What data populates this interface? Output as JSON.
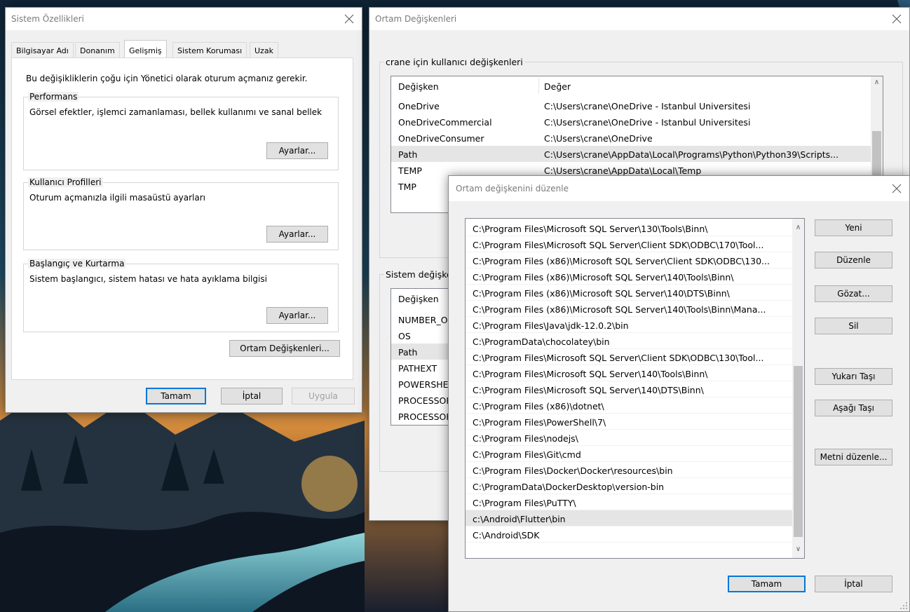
{
  "sysprops": {
    "title": "Sistem Özellikleri",
    "tabs": [
      "Bilgisayar Adı",
      "Donanım",
      "Gelişmiş",
      "Sistem Koruması",
      "Uzak"
    ],
    "admin_note": "Bu değişikliklerin çoğu için Yönetici olarak oturum açmanız gerekir.",
    "perf_label": "Performans",
    "perf_desc": "Görsel efektler, işlemci zamanlaması, bellek kullanımı ve sanal bellek",
    "profiles_label": "Kullanıcı Profilleri",
    "profiles_desc": "Oturum açmanızla ilgili masaüstü ayarları",
    "startup_label": "Başlangıç ve Kurtarma",
    "startup_desc": "Sistem başlangıcı, sistem hatası ve hata ayıklama bilgisi",
    "settings_btn": "Ayarlar...",
    "env_btn": "Ortam Değişkenleri...",
    "ok_btn": "Tamam",
    "cancel_btn": "İptal",
    "apply_btn": "Uygula"
  },
  "envvars": {
    "title": "Ortam Değişkenleri",
    "user_group_label": "crane için kullanıcı değişkenleri",
    "col_var": "Değişken",
    "col_val": "Değer",
    "user_vars": [
      {
        "name": "OneDrive",
        "value": "C:\\Users\\crane\\OneDrive - Istanbul Universitesi"
      },
      {
        "name": "OneDriveCommercial",
        "value": "C:\\Users\\crane\\OneDrive - Istanbul Universitesi"
      },
      {
        "name": "OneDriveConsumer",
        "value": "C:\\Users\\crane\\OneDrive"
      },
      {
        "name": "Path",
        "value": "C:\\Users\\crane\\AppData\\Local\\Programs\\Python\\Python39\\Scripts..."
      },
      {
        "name": "TEMP",
        "value": "C:\\Users\\crane\\AppData\\Local\\Temp"
      },
      {
        "name": "TMP",
        "value": ""
      }
    ],
    "sys_group_label": "Sistem değişkenleri",
    "sys_vars": [
      "NUMBER_OF_PROCESSORS",
      "OS",
      "Path",
      "PATHEXT",
      "POWERSHELL_DISTRIBUTION_CHANNEL",
      "PROCESSOR_ARCHITECTURE",
      "PROCESSOR_IDENTIFIER"
    ]
  },
  "editvar": {
    "title": "Ortam değişkenini düzenle",
    "paths": [
      "C:\\Program Files\\Microsoft SQL Server\\130\\Tools\\Binn\\",
      "C:\\Program Files\\Microsoft SQL Server\\Client SDK\\ODBC\\170\\Tool...",
      "C:\\Program Files (x86)\\Microsoft SQL Server\\Client SDK\\ODBC\\130...",
      "C:\\Program Files (x86)\\Microsoft SQL Server\\140\\Tools\\Binn\\",
      "C:\\Program Files (x86)\\Microsoft SQL Server\\140\\DTS\\Binn\\",
      "C:\\Program Files (x86)\\Microsoft SQL Server\\140\\Tools\\Binn\\Mana...",
      "C:\\Program Files\\Java\\jdk-12.0.2\\bin",
      "C:\\ProgramData\\chocolatey\\bin",
      "C:\\Program Files\\Microsoft SQL Server\\Client SDK\\ODBC\\130\\Tool...",
      "C:\\Program Files\\Microsoft SQL Server\\140\\Tools\\Binn\\",
      "C:\\Program Files\\Microsoft SQL Server\\140\\DTS\\Binn\\",
      "C:\\Program Files (x86)\\dotnet\\",
      "C:\\Program Files\\PowerShell\\7\\",
      "C:\\Program Files\\nodejs\\",
      "C:\\Program Files\\Git\\cmd",
      "C:\\Program Files\\Docker\\Docker\\resources\\bin",
      "C:\\ProgramData\\DockerDesktop\\version-bin",
      "C:\\Program Files\\PuTTY\\",
      "c:\\Android\\Flutter\\bin",
      "C:\\Android\\SDK"
    ],
    "selected_index": 18,
    "buttons": {
      "new": "Yeni",
      "edit": "Düzenle",
      "browse": "Gözat...",
      "delete": "Sil",
      "move_up": "Yukarı Taşı",
      "move_down": "Aşağı Taşı",
      "edit_text": "Metni düzenle...",
      "ok": "Tamam",
      "cancel": "İptal"
    }
  }
}
